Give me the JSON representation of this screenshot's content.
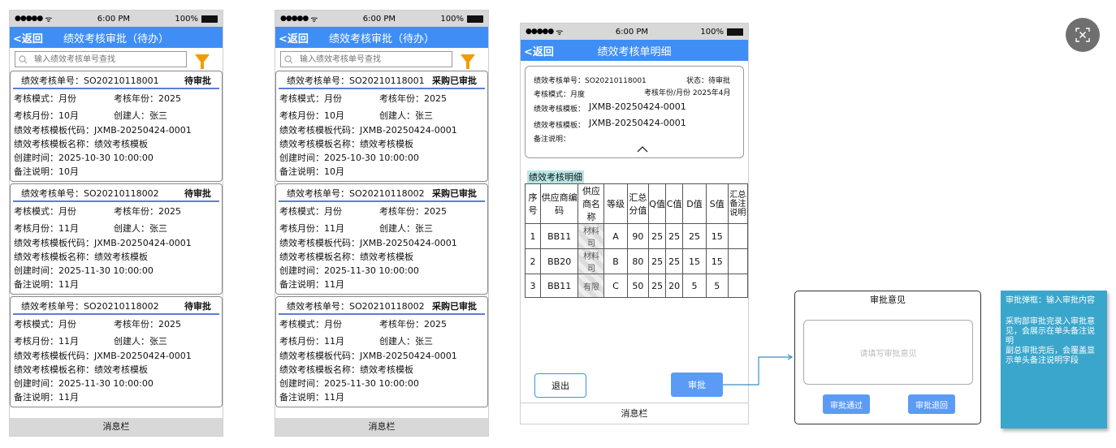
{
  "status_bar": {
    "signal": "●●●●● ",
    "wifi": "ᯤ",
    "time": "6:00 PM",
    "battery_pct": "100%"
  },
  "list": {
    "back_label": "<返回",
    "title": "绩效考核审批（待办）",
    "search_placeholder": "输入绩效考核单号查找",
    "message_bar": "消息栏",
    "fields": {
      "order_no": "绩效考核单号：",
      "mode": "考核模式：",
      "year": "考核年份：",
      "month": "考核月份：",
      "creator": "创建人：",
      "template_code": "绩效考核模板代码：",
      "template_name": "绩效考核模板名称：",
      "created_at": "创建时间：",
      "remark": "备注说明："
    },
    "phone1_status": "待审批",
    "phone2_status": "采购已审批",
    "cards": [
      {
        "order_no": "SO20210118001",
        "mode": "月份",
        "year": "2025",
        "month": "10月",
        "creator": "张三",
        "template_code": "JXMB-20250424-0001",
        "template_name": "绩效考核模板",
        "created_at": "2025-10-30 10:00:00",
        "remark": "10月"
      },
      {
        "order_no": "SO20210118002",
        "mode": "月份",
        "year": "2025",
        "month": "11月",
        "creator": "张三",
        "template_code": "JXMB-20250424-0001",
        "template_name": "绩效考核模板",
        "created_at": "2025-11-30 10:00:00",
        "remark": "11月"
      },
      {
        "order_no": "SO20210118002",
        "mode": "月份",
        "year": "2025",
        "month": "11月",
        "creator": "张三",
        "template_code": "JXMB-20250424-0001",
        "template_name": "绩效考核模板",
        "created_at": "2025-11-30 10:00:00",
        "remark": "11月"
      }
    ]
  },
  "detail": {
    "back_label": "<返回",
    "title": "绩效考核单明细",
    "info": {
      "order_no": "绩效考核单号：SO20210118001",
      "status": "状态：待审批",
      "mode": "考核模式：月度",
      "period": "考核年份/月份  2025年4月",
      "template_code": "绩效考核模板：",
      "template_code_val": "JXMB-20250424-0001",
      "template_name": "绩效考核模板：",
      "template_name_val": "JXMB-20250424-0001",
      "remark": "备注说明："
    },
    "section_label": "绩效考核明细",
    "table": {
      "headers": [
        "序号",
        "供应商编码",
        "供应商名称",
        "等级",
        "汇总分值",
        "Q值",
        "C值",
        "D值",
        "S值",
        "汇总备注说明"
      ],
      "rows": [
        [
          "1",
          "BB11",
          "",
          "A",
          "90",
          "25",
          "25",
          "25",
          "15",
          ""
        ],
        [
          "2",
          "BB20",
          "",
          "B",
          "80",
          "25",
          "25",
          "15",
          "15",
          ""
        ],
        [
          "3",
          "BB11",
          "",
          "C",
          "50",
          "25",
          "20",
          "5",
          "5",
          ""
        ]
      ],
      "name_fragments": [
        "材料\n司",
        "材料\n司",
        "有限"
      ]
    },
    "exit_label": "退出",
    "approve_label": "审批",
    "message_bar": "消息栏"
  },
  "dialog": {
    "title": "审批意见",
    "placeholder": "请填写审批意见",
    "pass_label": "审批通过",
    "reject_label": "审批退回"
  },
  "note": {
    "line1": "审批弹框：输入审批内容",
    "line2": "采购部审批完录入审批意见，会展示在单头备注说明",
    "line3": "副总审批完后，会覆盖显示单头备注说明字段"
  },
  "colors": {
    "header_blue": "#3f8ef5",
    "button_blue": "#5b9bf5",
    "filter_orange": "#f29b00",
    "note_teal": "#3aa6cc",
    "section_highlight": "#b8e6e6"
  }
}
